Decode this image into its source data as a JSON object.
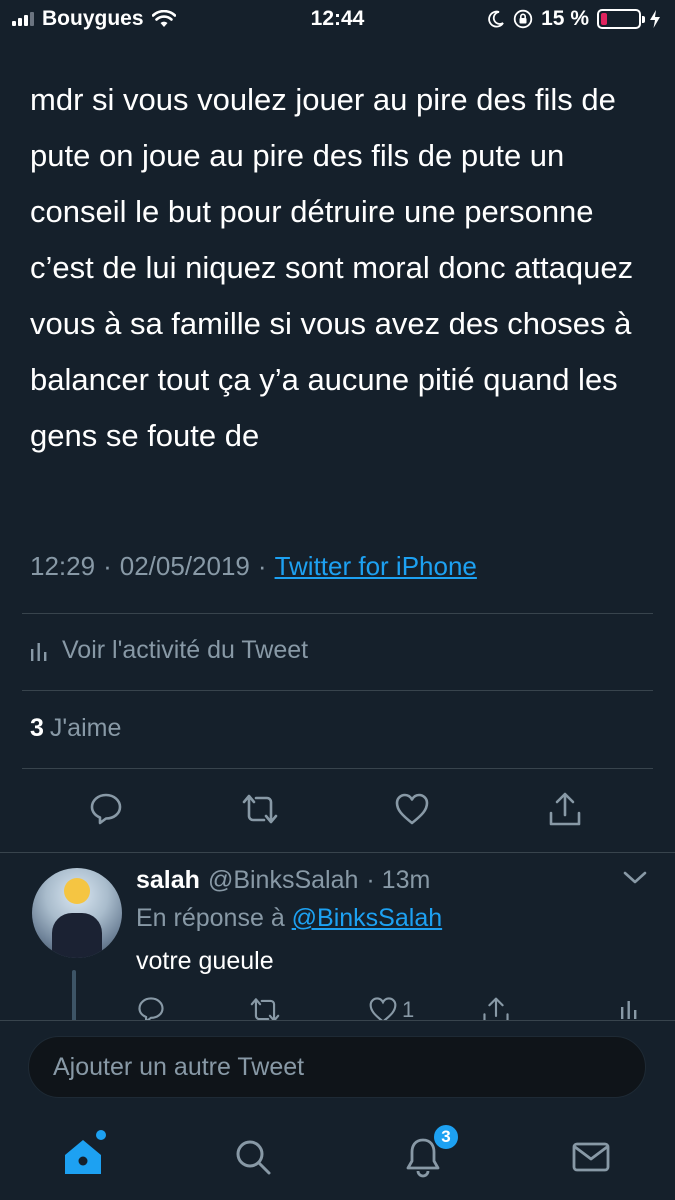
{
  "status_bar": {
    "carrier": "Bouygues",
    "time": "12:44",
    "battery_percent": "15 %",
    "battery_level": 0.15
  },
  "tweet": {
    "text": "mdr si vous voulez jouer au pire des fils de pute on joue au pire des fils de pute un conseil le but pour détruire une personne c’est de lui niquez sont moral donc attaquez vous à sa famille si vous avez des choses à balancer tout ça y’a aucune pitié quand les gens se foute de",
    "time": "12:29",
    "separator": "·",
    "date": "02/05/2019",
    "client": "Twitter for iPhone",
    "activity_label": "Voir l'activité du Tweet",
    "like_count": "3",
    "like_label": "J'aime"
  },
  "reply": {
    "name": "salah",
    "handle": "@BinksSalah",
    "age": "· 13m",
    "reply_prefix": "En réponse à",
    "reply_mention": "@BinksSalah",
    "text": "votre gueule",
    "likes": "1"
  },
  "composer": {
    "placeholder": "Ajouter un autre Tweet"
  },
  "tabbar": {
    "notifications_badge": "3"
  },
  "colors": {
    "background": "#15202b",
    "accent": "#1da1f2",
    "muted": "#8899a6",
    "divider": "#38444d"
  }
}
